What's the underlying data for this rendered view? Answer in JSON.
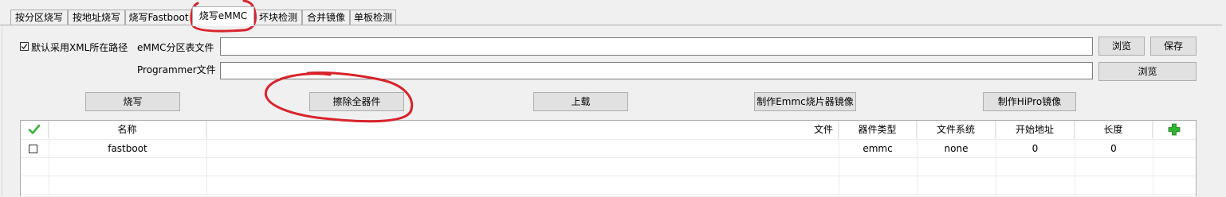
{
  "tabs": [
    {
      "label": "按分区烧写",
      "active": false
    },
    {
      "label": "按地址烧写",
      "active": false
    },
    {
      "label": "烧写Fastboot",
      "active": false
    },
    {
      "label": "烧写eMMC",
      "active": true
    },
    {
      "label": "坏块检测",
      "active": false
    },
    {
      "label": "合并镜像",
      "active": false
    },
    {
      "label": "单板检测",
      "active": false
    }
  ],
  "form": {
    "default_xml_checkbox": {
      "label": "默认采用XML所在路径",
      "checked": true
    },
    "partition_table_label": "eMMC分区表文件",
    "partition_table_value": "",
    "browse_label_1": "浏览",
    "save_label": "保存",
    "programmer_label": "Programmer文件",
    "programmer_value": "",
    "browse_label_2": "浏览"
  },
  "actions": {
    "burn": "烧写",
    "erase_all": "擦除全器件",
    "upload": "上载",
    "make_emmc_image": "制作Emmc烧片器镜像",
    "make_hipro_image": "制作HiPro镜像"
  },
  "table": {
    "header_check_icon": "green-check-icon",
    "add_icon": "green-plus-icon",
    "headers": {
      "name": "名称",
      "file": "文件",
      "device_type": "器件类型",
      "file_system": "文件系统",
      "start_address": "开始地址",
      "length": "长度"
    },
    "rows": [
      {
        "checked": false,
        "name": "fastboot",
        "file": "",
        "device_type": "emmc",
        "file_system": "none",
        "start_address": "0",
        "length": "0"
      }
    ]
  },
  "colors": {
    "annotation_red": "#d8232a",
    "check_green": "#3cb53c",
    "plus_green": "#2fb52f"
  }
}
